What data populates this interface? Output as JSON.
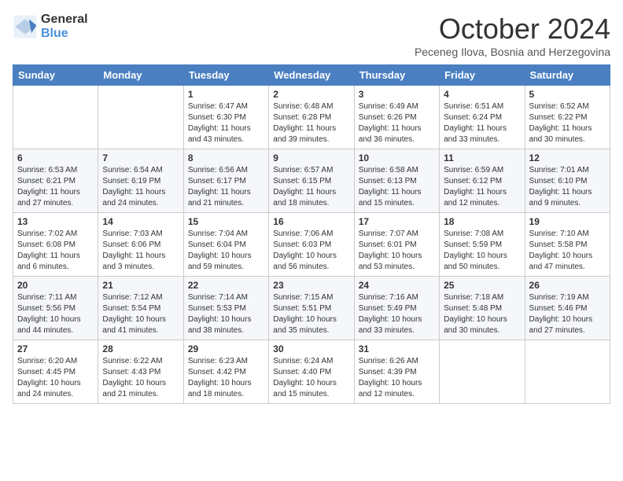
{
  "logo": {
    "general": "General",
    "blue": "Blue"
  },
  "title": "October 2024",
  "location": "Peceneg Ilova, Bosnia and Herzegovina",
  "weekdays": [
    "Sunday",
    "Monday",
    "Tuesday",
    "Wednesday",
    "Thursday",
    "Friday",
    "Saturday"
  ],
  "weeks": [
    [
      {
        "day": "",
        "info": ""
      },
      {
        "day": "",
        "info": ""
      },
      {
        "day": "1",
        "info": "Sunrise: 6:47 AM\nSunset: 6:30 PM\nDaylight: 11 hours and 43 minutes."
      },
      {
        "day": "2",
        "info": "Sunrise: 6:48 AM\nSunset: 6:28 PM\nDaylight: 11 hours and 39 minutes."
      },
      {
        "day": "3",
        "info": "Sunrise: 6:49 AM\nSunset: 6:26 PM\nDaylight: 11 hours and 36 minutes."
      },
      {
        "day": "4",
        "info": "Sunrise: 6:51 AM\nSunset: 6:24 PM\nDaylight: 11 hours and 33 minutes."
      },
      {
        "day": "5",
        "info": "Sunrise: 6:52 AM\nSunset: 6:22 PM\nDaylight: 11 hours and 30 minutes."
      }
    ],
    [
      {
        "day": "6",
        "info": "Sunrise: 6:53 AM\nSunset: 6:21 PM\nDaylight: 11 hours and 27 minutes."
      },
      {
        "day": "7",
        "info": "Sunrise: 6:54 AM\nSunset: 6:19 PM\nDaylight: 11 hours and 24 minutes."
      },
      {
        "day": "8",
        "info": "Sunrise: 6:56 AM\nSunset: 6:17 PM\nDaylight: 11 hours and 21 minutes."
      },
      {
        "day": "9",
        "info": "Sunrise: 6:57 AM\nSunset: 6:15 PM\nDaylight: 11 hours and 18 minutes."
      },
      {
        "day": "10",
        "info": "Sunrise: 6:58 AM\nSunset: 6:13 PM\nDaylight: 11 hours and 15 minutes."
      },
      {
        "day": "11",
        "info": "Sunrise: 6:59 AM\nSunset: 6:12 PM\nDaylight: 11 hours and 12 minutes."
      },
      {
        "day": "12",
        "info": "Sunrise: 7:01 AM\nSunset: 6:10 PM\nDaylight: 11 hours and 9 minutes."
      }
    ],
    [
      {
        "day": "13",
        "info": "Sunrise: 7:02 AM\nSunset: 6:08 PM\nDaylight: 11 hours and 6 minutes."
      },
      {
        "day": "14",
        "info": "Sunrise: 7:03 AM\nSunset: 6:06 PM\nDaylight: 11 hours and 3 minutes."
      },
      {
        "day": "15",
        "info": "Sunrise: 7:04 AM\nSunset: 6:04 PM\nDaylight: 10 hours and 59 minutes."
      },
      {
        "day": "16",
        "info": "Sunrise: 7:06 AM\nSunset: 6:03 PM\nDaylight: 10 hours and 56 minutes."
      },
      {
        "day": "17",
        "info": "Sunrise: 7:07 AM\nSunset: 6:01 PM\nDaylight: 10 hours and 53 minutes."
      },
      {
        "day": "18",
        "info": "Sunrise: 7:08 AM\nSunset: 5:59 PM\nDaylight: 10 hours and 50 minutes."
      },
      {
        "day": "19",
        "info": "Sunrise: 7:10 AM\nSunset: 5:58 PM\nDaylight: 10 hours and 47 minutes."
      }
    ],
    [
      {
        "day": "20",
        "info": "Sunrise: 7:11 AM\nSunset: 5:56 PM\nDaylight: 10 hours and 44 minutes."
      },
      {
        "day": "21",
        "info": "Sunrise: 7:12 AM\nSunset: 5:54 PM\nDaylight: 10 hours and 41 minutes."
      },
      {
        "day": "22",
        "info": "Sunrise: 7:14 AM\nSunset: 5:53 PM\nDaylight: 10 hours and 38 minutes."
      },
      {
        "day": "23",
        "info": "Sunrise: 7:15 AM\nSunset: 5:51 PM\nDaylight: 10 hours and 35 minutes."
      },
      {
        "day": "24",
        "info": "Sunrise: 7:16 AM\nSunset: 5:49 PM\nDaylight: 10 hours and 33 minutes."
      },
      {
        "day": "25",
        "info": "Sunrise: 7:18 AM\nSunset: 5:48 PM\nDaylight: 10 hours and 30 minutes."
      },
      {
        "day": "26",
        "info": "Sunrise: 7:19 AM\nSunset: 5:46 PM\nDaylight: 10 hours and 27 minutes."
      }
    ],
    [
      {
        "day": "27",
        "info": "Sunrise: 6:20 AM\nSunset: 4:45 PM\nDaylight: 10 hours and 24 minutes."
      },
      {
        "day": "28",
        "info": "Sunrise: 6:22 AM\nSunset: 4:43 PM\nDaylight: 10 hours and 21 minutes."
      },
      {
        "day": "29",
        "info": "Sunrise: 6:23 AM\nSunset: 4:42 PM\nDaylight: 10 hours and 18 minutes."
      },
      {
        "day": "30",
        "info": "Sunrise: 6:24 AM\nSunset: 4:40 PM\nDaylight: 10 hours and 15 minutes."
      },
      {
        "day": "31",
        "info": "Sunrise: 6:26 AM\nSunset: 4:39 PM\nDaylight: 10 hours and 12 minutes."
      },
      {
        "day": "",
        "info": ""
      },
      {
        "day": "",
        "info": ""
      }
    ]
  ]
}
